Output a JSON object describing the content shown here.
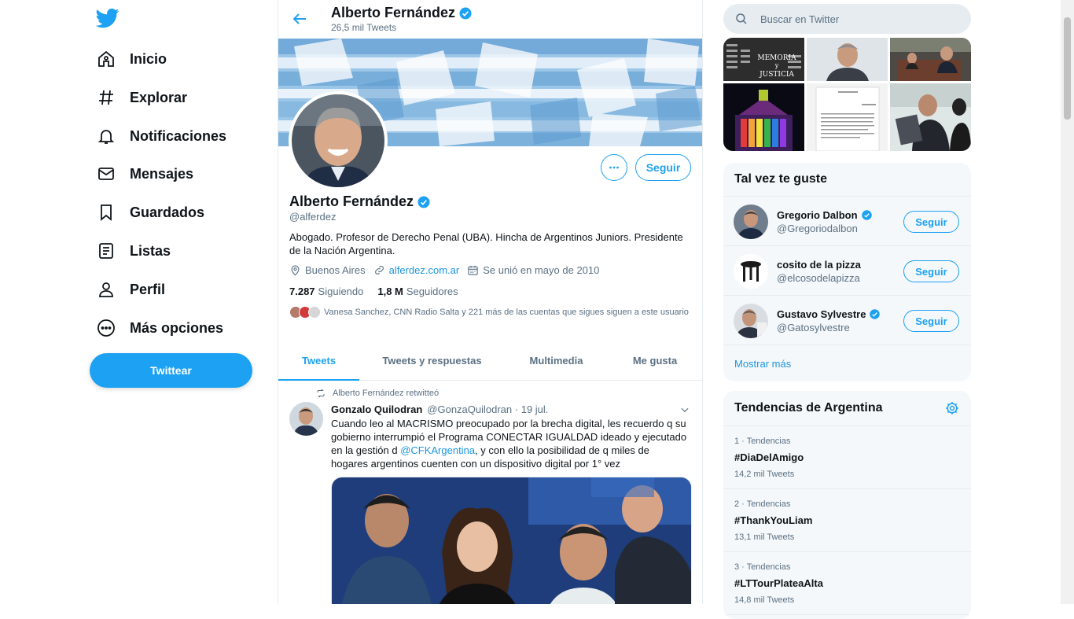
{
  "colors": {
    "accent": "#1da1f2",
    "link": "#1b95e0",
    "secondary_text": "#5b7083",
    "panel_bg": "#f5f8fa"
  },
  "nav": {
    "logo": "twitter-bird-icon",
    "items": [
      {
        "label": "Inicio",
        "icon": "home-icon"
      },
      {
        "label": "Explorar",
        "icon": "hashtag-icon"
      },
      {
        "label": "Notificaciones",
        "icon": "bell-icon"
      },
      {
        "label": "Mensajes",
        "icon": "mail-icon"
      },
      {
        "label": "Guardados",
        "icon": "bookmark-icon"
      },
      {
        "label": "Listas",
        "icon": "list-icon"
      },
      {
        "label": "Perfil",
        "icon": "person-icon"
      },
      {
        "label": "Más opciones",
        "icon": "more-circle-icon"
      }
    ],
    "tweet_button": "Twittear"
  },
  "header": {
    "name": "Alberto Fernández",
    "tweet_count": "26,5 mil Tweets"
  },
  "profile": {
    "name": "Alberto Fernández",
    "handle": "@alferdez",
    "bio": "Abogado. Profesor de Derecho Penal (UBA). Hincha de Argentinos Juniors. Presidente de la Nación Argentina.",
    "location": "Buenos Aires",
    "website": "alferdez.com.ar",
    "joined": "Se unió en mayo de 2010",
    "following_count": "7.287",
    "following_label": "Siguiendo",
    "followers_count": "1,8 M",
    "followers_label": "Seguidores",
    "known_followers": "Vanesa Sanchez, CNN Radio Salta y 221 más de las cuentas que sigues siguen a este usuario",
    "follow_button": "Seguir"
  },
  "tabs": [
    "Tweets",
    "Tweets y respuestas",
    "Multimedia",
    "Me gusta"
  ],
  "tweet": {
    "retweet_note": "Alberto Fernández retwitteó",
    "author_name": "Gonzalo Quilodran",
    "author_handle": "@GonzaQuilodran",
    "date": "· 19 jul.",
    "text_before": "Cuando leo al MACRISMO preocupado por la brecha digital, les recuerdo q su gobierno interrumpió el Programa CONECTAR IGUALDAD ideado y ejecutado en la gestión d ",
    "mention": "@CFKArgentina",
    "text_after": ", y con ello la posibilidad de q miles de hogares argentinos cuenten con un dispositivo digital por 1° vez"
  },
  "search": {
    "placeholder": "Buscar en Twitter"
  },
  "suggestions": {
    "title": "Tal vez te guste",
    "items": [
      {
        "name": "Gregorio Dalbon",
        "handle": "@Gregoriodalbon",
        "verified": true,
        "button": "Seguir"
      },
      {
        "name": "cosito de la pizza",
        "handle": "@elcosodelapizza",
        "verified": false,
        "button": "Seguir"
      },
      {
        "name": "Gustavo Sylvestre",
        "handle": "@Gatosylvestre",
        "verified": true,
        "button": "Seguir"
      }
    ],
    "show_more": "Mostrar más"
  },
  "media_thumb_texts": {
    "memoria": "MEMORIA",
    "y": "y",
    "justicia": "JUSTICIA"
  },
  "trends": {
    "title": "Tendencias de Argentina",
    "items": [
      {
        "meta": "1 · Tendencias",
        "tag": "#DiaDelAmigo",
        "count": "14,2 mil Tweets"
      },
      {
        "meta": "2 · Tendencias",
        "tag": "#ThankYouLiam",
        "count": "13,1 mil Tweets"
      },
      {
        "meta": "3 · Tendencias",
        "tag": "#LTTourPlateaAlta",
        "count": "14,8 mil Tweets"
      }
    ]
  }
}
